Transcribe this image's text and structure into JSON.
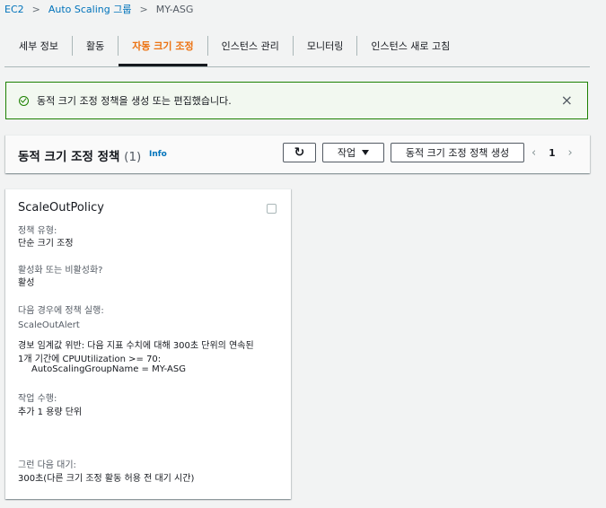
{
  "breadcrumb": {
    "items": [
      "EC2",
      "Auto Scaling 그룹",
      "MY-ASG"
    ],
    "separator": ">"
  },
  "tabs": [
    {
      "label": "세부 정보",
      "active": false
    },
    {
      "label": "활동",
      "active": false
    },
    {
      "label": "자동 크기 조정",
      "active": true
    },
    {
      "label": "인스턴스 관리",
      "active": false
    },
    {
      "label": "모니터링",
      "active": false
    },
    {
      "label": "인스턴스 새로 고침",
      "active": false
    }
  ],
  "flash": {
    "message": "동적 크기 조정 정책을 생성 또는 편집했습니다.",
    "close_icon": "×"
  },
  "panel": {
    "title": "동적 크기 조정 정책",
    "count": "(1)",
    "info": "Info",
    "refresh_icon": "↻",
    "actions_label": "작업",
    "create_label": "동적 크기 조정 정책 생성",
    "prev_icon": "‹",
    "page": "1",
    "next_icon": "›"
  },
  "policy": {
    "name": "ScaleOutPolicy",
    "type_label": "정책 유형:",
    "type_value": "단순 크기 조정",
    "enabled_label": "활성화 또는 비활성화?",
    "enabled_value": "활성",
    "trigger_label": "다음 경우에 정책 실행:",
    "alarm_name": "ScaleOutAlert",
    "breach_line1": "경보 임계값 위반: 다음 지표 수치에 대해 300초 단위의 연속된",
    "breach_line2": "1개 기간에 CPUUtilization >= 70:",
    "dimension": "AutoScalingGroupName = MY-ASG",
    "action_label": "작업 수행:",
    "action_value": "추가 1 용량 단위",
    "wait_label": "그런 다음 대기:",
    "wait_value": "300초(다른 크기 조정 활동 허용 전 대기 시간)"
  },
  "colors": {
    "accent": "#ec7211",
    "link": "#0073bb",
    "success": "#1d8102"
  }
}
